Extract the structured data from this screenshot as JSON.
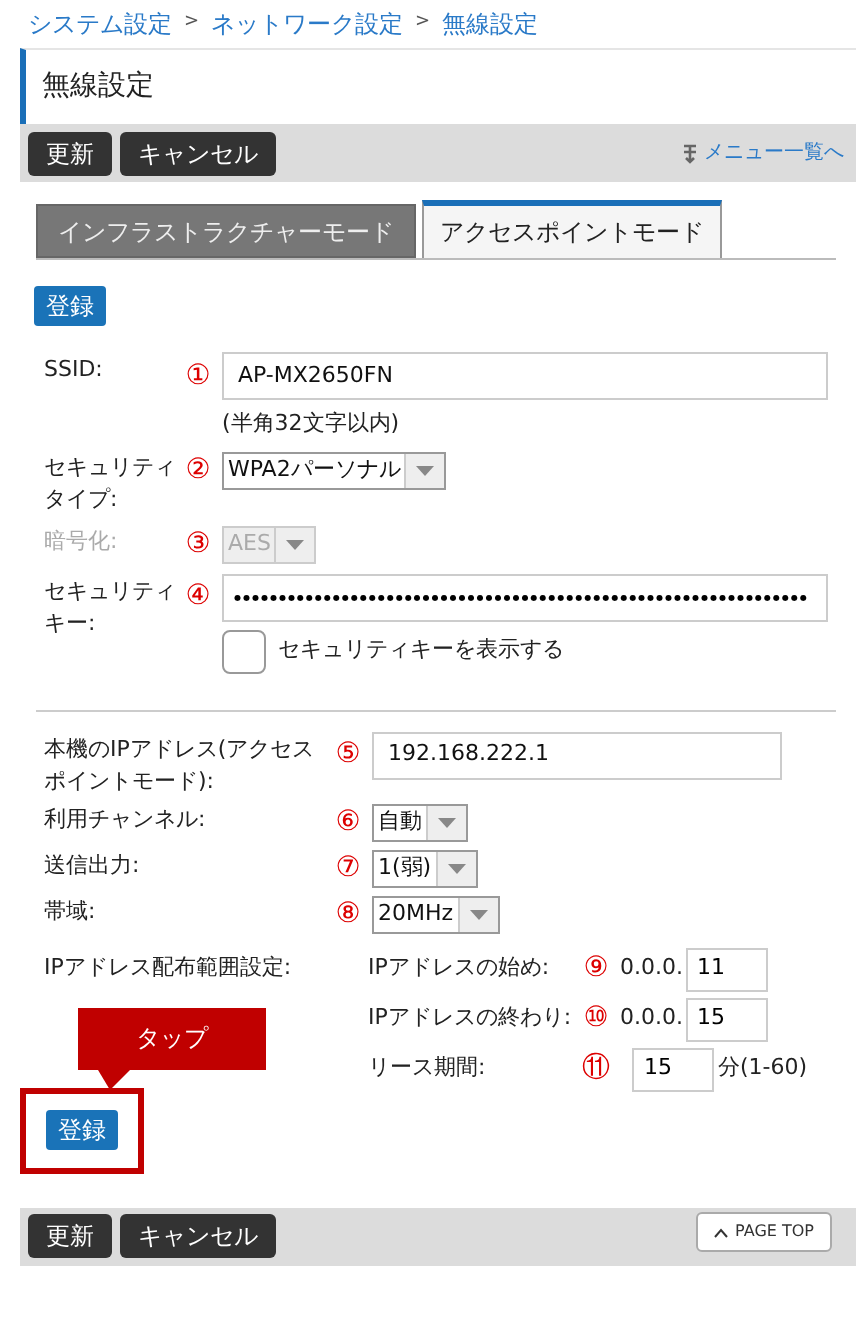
{
  "breadcrumb": {
    "items": [
      "システム設定",
      "ネットワーク設定",
      "無線設定"
    ],
    "separator": ">"
  },
  "page_title": "無線設定",
  "toolbar": {
    "buttons": [
      "更新",
      "キャンセル"
    ],
    "menu_link": "メニュー一覧へ"
  },
  "tabs": [
    {
      "label": "インフラストラクチャーモード",
      "selected": false
    },
    {
      "label": "アクセスポイントモード",
      "selected": true
    }
  ],
  "register_button": "登録",
  "wireless_fields": [
    {
      "kind": "text",
      "label": "SSID:",
      "marker": "①",
      "value": "AP-MX2650FN",
      "note": "(半角32文字以内)"
    },
    {
      "kind": "select",
      "label": "セキュリティタイプ:",
      "marker": "②",
      "value": "WPA2パーソナル",
      "disabled": false
    },
    {
      "kind": "select",
      "label": "暗号化:",
      "marker": "③",
      "value": "AES",
      "disabled": true
    },
    {
      "kind": "password",
      "label": "セキュリティキー:",
      "marker": "④",
      "value": "●●●●●●●●●●●●●●●●●●●●●●●●●●●●●●●●●●●●●●●●●●●●●●●●●●●●●●●●●●●●●●●●",
      "checkbox": {
        "label": "セキュリティキーを表示する",
        "checked": false
      }
    }
  ],
  "ap_fields": [
    {
      "kind": "text",
      "label": "本機のIPアドレス(アクセスポイントモード):",
      "marker": "⑤",
      "value": "192.168.222.1"
    },
    {
      "kind": "select",
      "label": "利用チャンネル:",
      "marker": "⑥",
      "value": "自動",
      "disabled": false
    },
    {
      "kind": "select",
      "label": "送信出力:",
      "marker": "⑦",
      "value": "1(弱)",
      "disabled": false
    },
    {
      "kind": "select",
      "label": "帯域:",
      "marker": "⑧",
      "value": "20MHz",
      "disabled": false
    }
  ],
  "ip_range": {
    "label": "IPアドレス配布範囲設定:",
    "items": [
      {
        "label": "IPアドレスの始め:",
        "marker": "⑨",
        "prefix": "0.0.0.",
        "value": "11"
      },
      {
        "label": "IPアドレスの終わり:",
        "marker": "⑩",
        "prefix": "0.0.0.",
        "value": "15"
      },
      {
        "label": "リース期間:",
        "marker": "⑪",
        "value": "15",
        "suffix": "分(1-60)"
      }
    ]
  },
  "callout": "タップ",
  "bottom_register": {
    "label": "登録",
    "highlighted": true
  },
  "bottom_toolbar": {
    "buttons": [
      "更新",
      "キャンセル"
    ],
    "page_top": "PAGE TOP"
  }
}
